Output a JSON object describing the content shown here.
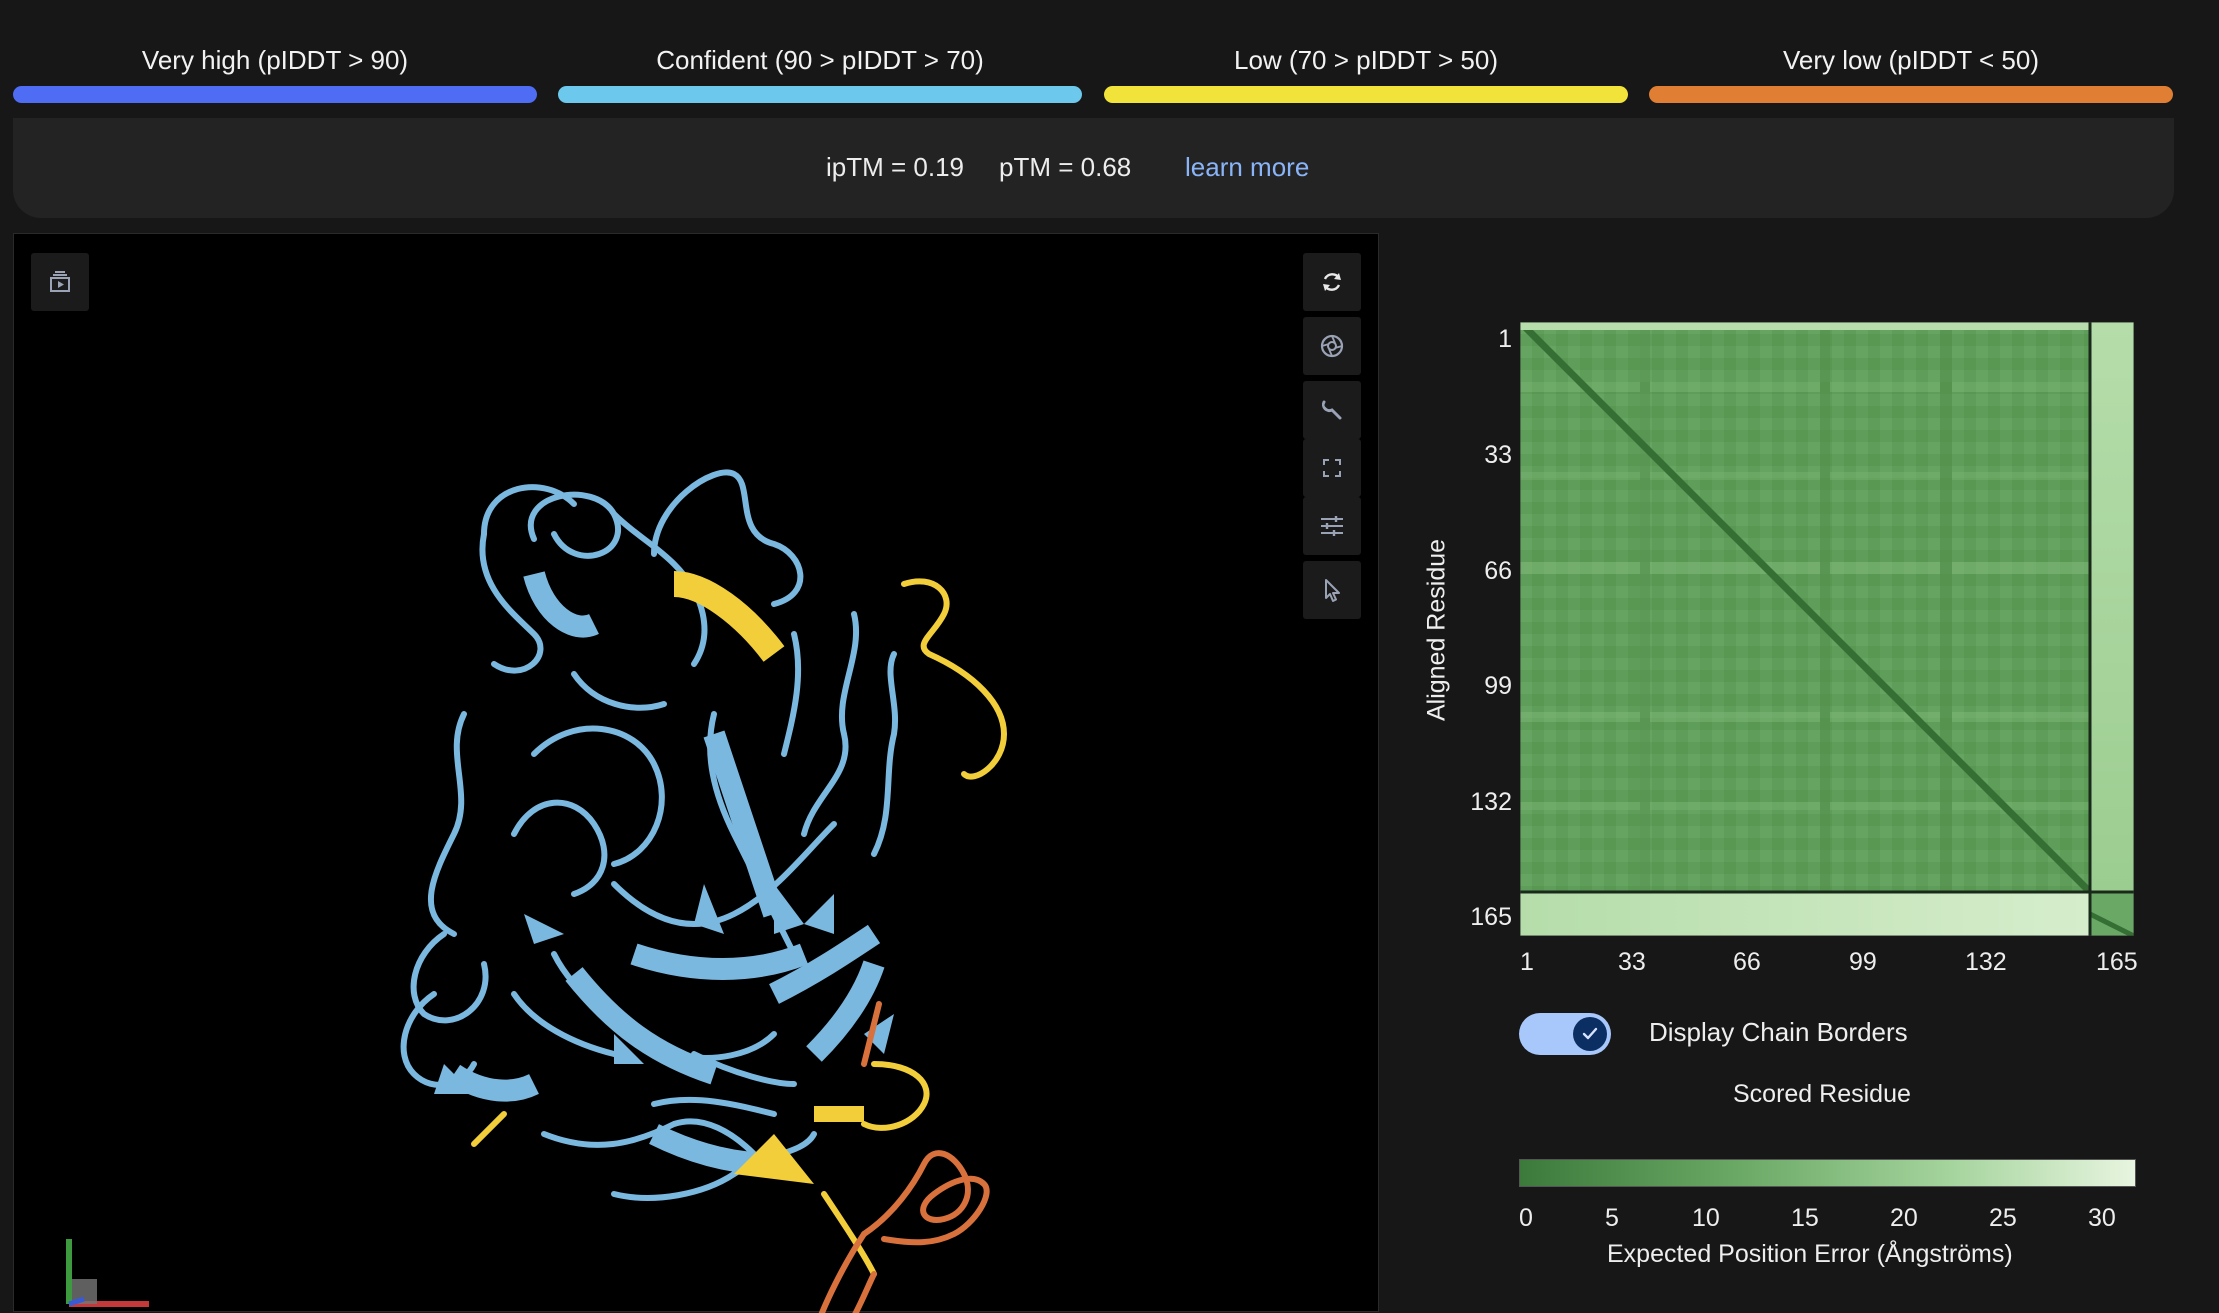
{
  "legend": [
    {
      "label": "Very high (pIDDT > 90)",
      "color": "#4f6cf5"
    },
    {
      "label": "Confident (90 > pIDDT > 70)",
      "color": "#6cc8ec"
    },
    {
      "label": "Low (70 > pIDDT > 50)",
      "color": "#f2e33a"
    },
    {
      "label": "Very low (pIDDT < 50)",
      "color": "#e07f33"
    }
  ],
  "metrics": {
    "iptm": "ipTM = 0.19",
    "ptm": "pTM = 0.68",
    "learn_more": "learn more"
  },
  "viewer": {
    "toolbar_icons": [
      "sequence-play-icon",
      "rotate-icon",
      "camera-icon",
      "wrench-icon",
      "fullscreen-icon",
      "settings-sliders-icon",
      "pointer-icon"
    ],
    "structure_colors": {
      "confident": "#7ab8df",
      "low": "#f2cf3a",
      "very_low": "#d9713d"
    }
  },
  "pae": {
    "y_label": "Aligned Residue",
    "x_label": "Scored Residue",
    "ticks": [
      "1",
      "33",
      "66",
      "99",
      "132",
      "165"
    ],
    "chain_border_residue": 157,
    "total_residues": 165,
    "toggle_label": "Display Chain Borders",
    "toggle_on": true,
    "colorbar_ticks": [
      "0",
      "5",
      "10",
      "15",
      "20",
      "25",
      "30"
    ],
    "colorbar_label": "Expected Position Error (Ångströms)",
    "colors": {
      "low_error": "#3b7a3b",
      "high_error": "#e8f5e0"
    }
  }
}
